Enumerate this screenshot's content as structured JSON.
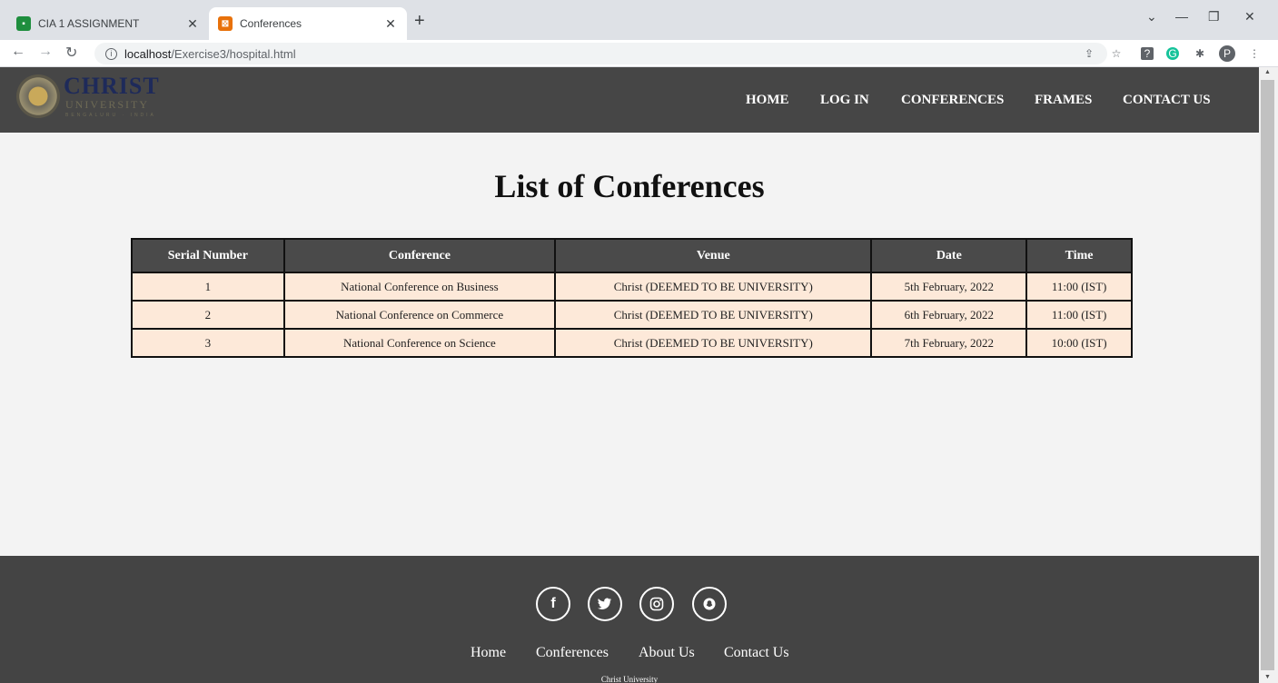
{
  "browser": {
    "tabs": [
      {
        "title": "CIA 1 ASSIGNMENT",
        "favicon": "classroom-icon",
        "active": false
      },
      {
        "title": "Conferences",
        "favicon": "page-favicon-icon",
        "active": true
      }
    ],
    "url_host": "localhost",
    "url_path": "/Exercise3/hospital.html",
    "profile_initial": "P"
  },
  "site": {
    "logo": {
      "name": "CHRIST",
      "sub": "UNIVERSITY",
      "place": "BENGALURU · INDIA"
    },
    "nav": [
      "HOME",
      "LOG IN",
      "CONFERENCES",
      "FRAMES",
      "CONTACT US"
    ]
  },
  "main": {
    "title": "List of Conferences",
    "table": {
      "headers": [
        "Serial Number",
        "Conference",
        "Venue",
        "Date",
        "Time"
      ],
      "rows": [
        [
          "1",
          "National Conference on Business",
          "Christ (DEEMED TO BE UNIVERSITY)",
          "5th February, 2022",
          "11:00 (IST)"
        ],
        [
          "2",
          "National Conference on Commerce",
          "Christ (DEEMED TO BE UNIVERSITY)",
          "6th February, 2022",
          "11:00 (IST)"
        ],
        [
          "3",
          "National Conference on Science",
          "Christ (DEEMED TO BE UNIVERSITY)",
          "7th February, 2022",
          "10:00 (IST)"
        ]
      ]
    }
  },
  "footer": {
    "social_icons": [
      "facebook-icon",
      "twitter-icon",
      "instagram-icon",
      "snapchat-icon"
    ],
    "links": [
      "Home",
      "Conferences",
      "About Us",
      "Contact Us"
    ],
    "copyright": "Christ University"
  },
  "colors": {
    "header_bg": "#464646",
    "table_header_bg": "#4a4a4a",
    "table_row_bg": "#fde9d9",
    "footer_bg": "#444444",
    "page_bg": "#f3f3f3"
  }
}
